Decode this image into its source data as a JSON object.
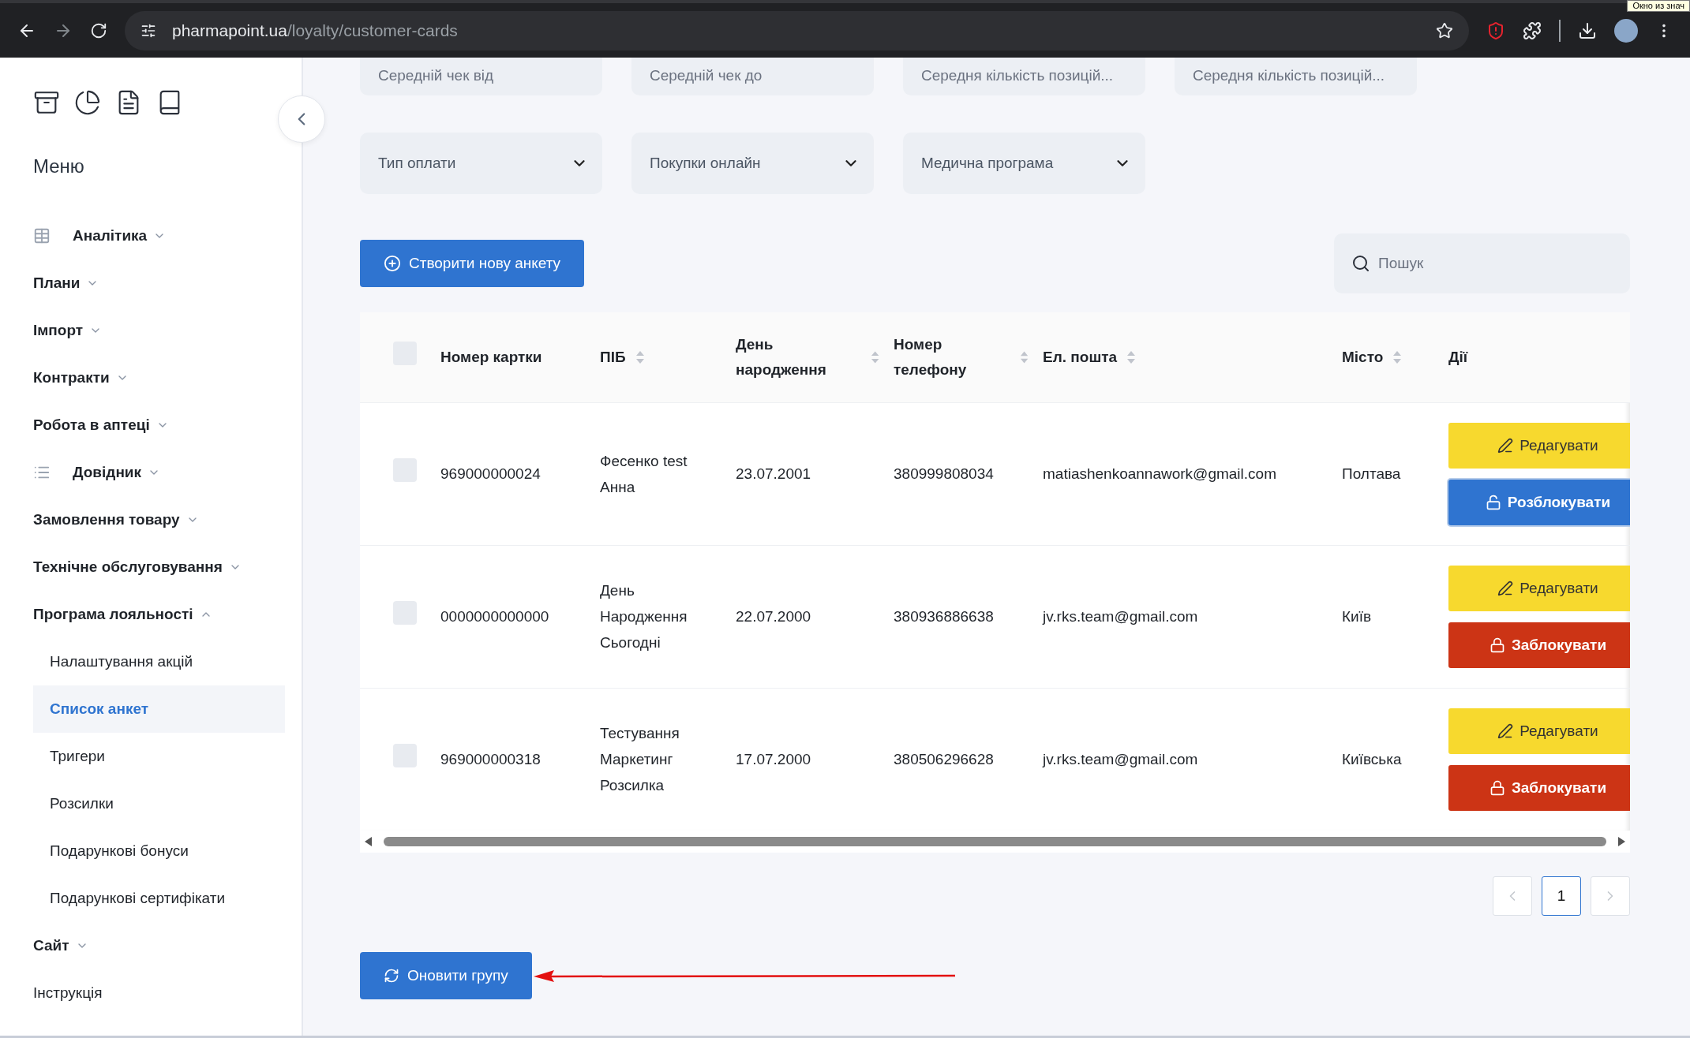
{
  "browser": {
    "url_host": "pharmapoint.ua",
    "url_path": "/loyalty/customer-cards",
    "tooltip": "Окно из знач"
  },
  "sidebar": {
    "title": "Меню",
    "items": [
      {
        "label": "Аналітика",
        "kind": "group",
        "expanded": false
      },
      {
        "label": "Плани",
        "kind": "group",
        "expanded": false
      },
      {
        "label": "Імпорт",
        "kind": "group",
        "expanded": false
      },
      {
        "label": "Контракти",
        "kind": "group",
        "expanded": false
      },
      {
        "label": "Робота в аптеці",
        "kind": "group",
        "expanded": false
      },
      {
        "label": "Довідник",
        "kind": "group",
        "expanded": false
      },
      {
        "label": "Замовлення товару",
        "kind": "group",
        "expanded": false
      },
      {
        "label": "Технічне обслуговування",
        "kind": "group",
        "expanded": false
      },
      {
        "label": "Програма лояльності",
        "kind": "group",
        "expanded": true,
        "children": [
          {
            "label": "Налаштування акцій",
            "selected": false
          },
          {
            "label": "Список анкет",
            "selected": true
          },
          {
            "label": "Тригери",
            "selected": false
          },
          {
            "label": "Розсилки",
            "selected": false
          },
          {
            "label": "Подарункові бонуси",
            "selected": false
          },
          {
            "label": "Подарункові сертифікати",
            "selected": false
          }
        ]
      },
      {
        "label": "Сайт",
        "kind": "group",
        "expanded": false
      },
      {
        "label": "Інструкція",
        "kind": "link"
      }
    ]
  },
  "filters": {
    "fields": [
      {
        "placeholder": "Середній чек від"
      },
      {
        "placeholder": "Середній чек до"
      },
      {
        "placeholder": "Середня кількість позицій..."
      },
      {
        "placeholder": "Середня кількість позицій..."
      }
    ],
    "selects": [
      {
        "placeholder": "Тип оплати"
      },
      {
        "placeholder": "Покупки онлайн"
      },
      {
        "placeholder": "Медична програма"
      }
    ]
  },
  "create_button": "Створити нову анкету",
  "search": {
    "placeholder": "Пошук"
  },
  "table": {
    "select_all_checked": false,
    "columns": [
      {
        "label": "Номер картки",
        "sortable": false
      },
      {
        "label": "ПІБ",
        "sortable": true
      },
      {
        "label": "День народження",
        "sortable": true
      },
      {
        "label": "Номер телефону",
        "sortable": true
      },
      {
        "label": "Ел. пошта",
        "sortable": true
      },
      {
        "label": "Місто",
        "sortable": true
      },
      {
        "label": "Дії",
        "sortable": false
      }
    ],
    "rows": [
      {
        "checked": false,
        "card": "969000000024",
        "name": "Фесенко test Анна",
        "birthday": "23.07.2001",
        "phone": "380999808034",
        "email": "matiashenkoannawork@gmail.com",
        "city": "Полтава",
        "actions": [
          {
            "label": "Редагувати",
            "kind": "edit"
          },
          {
            "label": "Розблокувати",
            "kind": "unblock"
          }
        ]
      },
      {
        "checked": false,
        "card": "0000000000000",
        "name": "День Народження Сьогодні",
        "birthday": "22.07.2000",
        "phone": "380936886638",
        "email": "jv.rks.team@gmail.com",
        "city": "Київ",
        "actions": [
          {
            "label": "Редагувати",
            "kind": "edit"
          },
          {
            "label": "Заблокувати",
            "kind": "block"
          }
        ]
      },
      {
        "checked": false,
        "card": "969000000318",
        "name": "Тестування Маркетинг Розсилка",
        "birthday": "17.07.2000",
        "phone": "380506296628",
        "email": "jv.rks.team@gmail.com",
        "city": "Київська",
        "actions": [
          {
            "label": "Редагувати",
            "kind": "edit"
          },
          {
            "label": "Заблокувати",
            "kind": "block"
          }
        ]
      }
    ]
  },
  "pagination": {
    "pages": [
      {
        "label": "1",
        "selected": true
      }
    ]
  },
  "refresh_button": "Оновити групу"
}
